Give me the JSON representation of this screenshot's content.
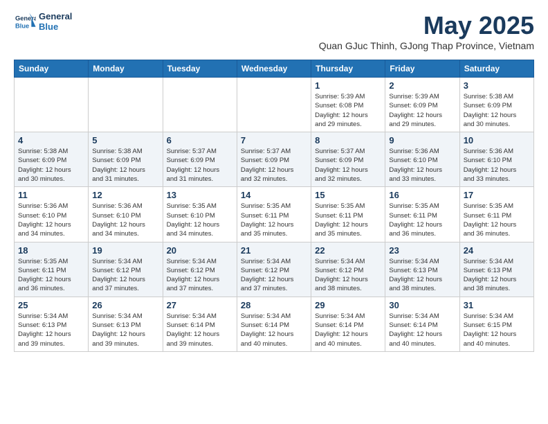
{
  "logo": {
    "line1": "General",
    "line2": "Blue"
  },
  "header": {
    "month_title": "May 2025",
    "subtitle": "Quan GJuc Thinh, GJong Thap Province, Vietnam"
  },
  "weekdays": [
    "Sunday",
    "Monday",
    "Tuesday",
    "Wednesday",
    "Thursday",
    "Friday",
    "Saturday"
  ],
  "weeks": [
    [
      {
        "day": "",
        "detail": ""
      },
      {
        "day": "",
        "detail": ""
      },
      {
        "day": "",
        "detail": ""
      },
      {
        "day": "",
        "detail": ""
      },
      {
        "day": "1",
        "detail": "Sunrise: 5:39 AM\nSunset: 6:08 PM\nDaylight: 12 hours\nand 29 minutes."
      },
      {
        "day": "2",
        "detail": "Sunrise: 5:39 AM\nSunset: 6:09 PM\nDaylight: 12 hours\nand 29 minutes."
      },
      {
        "day": "3",
        "detail": "Sunrise: 5:38 AM\nSunset: 6:09 PM\nDaylight: 12 hours\nand 30 minutes."
      }
    ],
    [
      {
        "day": "4",
        "detail": "Sunrise: 5:38 AM\nSunset: 6:09 PM\nDaylight: 12 hours\nand 30 minutes."
      },
      {
        "day": "5",
        "detail": "Sunrise: 5:38 AM\nSunset: 6:09 PM\nDaylight: 12 hours\nand 31 minutes."
      },
      {
        "day": "6",
        "detail": "Sunrise: 5:37 AM\nSunset: 6:09 PM\nDaylight: 12 hours\nand 31 minutes."
      },
      {
        "day": "7",
        "detail": "Sunrise: 5:37 AM\nSunset: 6:09 PM\nDaylight: 12 hours\nand 32 minutes."
      },
      {
        "day": "8",
        "detail": "Sunrise: 5:37 AM\nSunset: 6:09 PM\nDaylight: 12 hours\nand 32 minutes."
      },
      {
        "day": "9",
        "detail": "Sunrise: 5:36 AM\nSunset: 6:10 PM\nDaylight: 12 hours\nand 33 minutes."
      },
      {
        "day": "10",
        "detail": "Sunrise: 5:36 AM\nSunset: 6:10 PM\nDaylight: 12 hours\nand 33 minutes."
      }
    ],
    [
      {
        "day": "11",
        "detail": "Sunrise: 5:36 AM\nSunset: 6:10 PM\nDaylight: 12 hours\nand 34 minutes."
      },
      {
        "day": "12",
        "detail": "Sunrise: 5:36 AM\nSunset: 6:10 PM\nDaylight: 12 hours\nand 34 minutes."
      },
      {
        "day": "13",
        "detail": "Sunrise: 5:35 AM\nSunset: 6:10 PM\nDaylight: 12 hours\nand 34 minutes."
      },
      {
        "day": "14",
        "detail": "Sunrise: 5:35 AM\nSunset: 6:11 PM\nDaylight: 12 hours\nand 35 minutes."
      },
      {
        "day": "15",
        "detail": "Sunrise: 5:35 AM\nSunset: 6:11 PM\nDaylight: 12 hours\nand 35 minutes."
      },
      {
        "day": "16",
        "detail": "Sunrise: 5:35 AM\nSunset: 6:11 PM\nDaylight: 12 hours\nand 36 minutes."
      },
      {
        "day": "17",
        "detail": "Sunrise: 5:35 AM\nSunset: 6:11 PM\nDaylight: 12 hours\nand 36 minutes."
      }
    ],
    [
      {
        "day": "18",
        "detail": "Sunrise: 5:35 AM\nSunset: 6:11 PM\nDaylight: 12 hours\nand 36 minutes."
      },
      {
        "day": "19",
        "detail": "Sunrise: 5:34 AM\nSunset: 6:12 PM\nDaylight: 12 hours\nand 37 minutes."
      },
      {
        "day": "20",
        "detail": "Sunrise: 5:34 AM\nSunset: 6:12 PM\nDaylight: 12 hours\nand 37 minutes."
      },
      {
        "day": "21",
        "detail": "Sunrise: 5:34 AM\nSunset: 6:12 PM\nDaylight: 12 hours\nand 37 minutes."
      },
      {
        "day": "22",
        "detail": "Sunrise: 5:34 AM\nSunset: 6:12 PM\nDaylight: 12 hours\nand 38 minutes."
      },
      {
        "day": "23",
        "detail": "Sunrise: 5:34 AM\nSunset: 6:13 PM\nDaylight: 12 hours\nand 38 minutes."
      },
      {
        "day": "24",
        "detail": "Sunrise: 5:34 AM\nSunset: 6:13 PM\nDaylight: 12 hours\nand 38 minutes."
      }
    ],
    [
      {
        "day": "25",
        "detail": "Sunrise: 5:34 AM\nSunset: 6:13 PM\nDaylight: 12 hours\nand 39 minutes."
      },
      {
        "day": "26",
        "detail": "Sunrise: 5:34 AM\nSunset: 6:13 PM\nDaylight: 12 hours\nand 39 minutes."
      },
      {
        "day": "27",
        "detail": "Sunrise: 5:34 AM\nSunset: 6:14 PM\nDaylight: 12 hours\nand 39 minutes."
      },
      {
        "day": "28",
        "detail": "Sunrise: 5:34 AM\nSunset: 6:14 PM\nDaylight: 12 hours\nand 40 minutes."
      },
      {
        "day": "29",
        "detail": "Sunrise: 5:34 AM\nSunset: 6:14 PM\nDaylight: 12 hours\nand 40 minutes."
      },
      {
        "day": "30",
        "detail": "Sunrise: 5:34 AM\nSunset: 6:14 PM\nDaylight: 12 hours\nand 40 minutes."
      },
      {
        "day": "31",
        "detail": "Sunrise: 5:34 AM\nSunset: 6:15 PM\nDaylight: 12 hours\nand 40 minutes."
      }
    ]
  ]
}
